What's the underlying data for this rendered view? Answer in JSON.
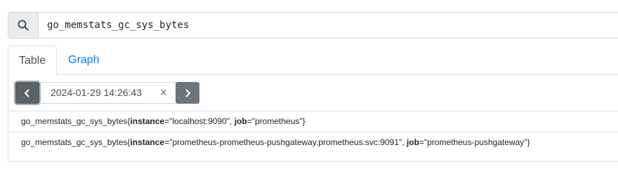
{
  "query": {
    "expression": "go_memstats_gc_sys_bytes"
  },
  "tabs": [
    {
      "label": "Table",
      "active": true
    },
    {
      "label": "Graph",
      "active": false
    }
  ],
  "time": {
    "value": "2024-01-29 14:26:43",
    "clear_symbol": "×"
  },
  "results": [
    {
      "metric": "go_memstats_gc_sys_bytes",
      "open_brace": "{",
      "labels": [
        {
          "name": "instance",
          "eq": "=",
          "value": "\"localhost:9090\"",
          "sep": ", "
        },
        {
          "name": "job",
          "eq": "=",
          "value": "\"prometheus\"",
          "sep": ""
        }
      ],
      "close_brace": "}"
    },
    {
      "metric": "go_memstats_gc_sys_bytes",
      "open_brace": "{",
      "labels": [
        {
          "name": "instance",
          "eq": "=",
          "value": "\"prometheus-prometheus-pushgateway.prometheus.svc:9091\"",
          "sep": ", "
        },
        {
          "name": "job",
          "eq": "=",
          "value": "\"prometheus-pushgateway\"",
          "sep": ""
        }
      ],
      "close_brace": "}"
    }
  ],
  "icons": {
    "search": "search-icon",
    "prev": "chevron-left-icon",
    "next": "chevron-right-icon"
  },
  "colors": {
    "link": "#007bff",
    "nav_button": "#6c757d"
  }
}
